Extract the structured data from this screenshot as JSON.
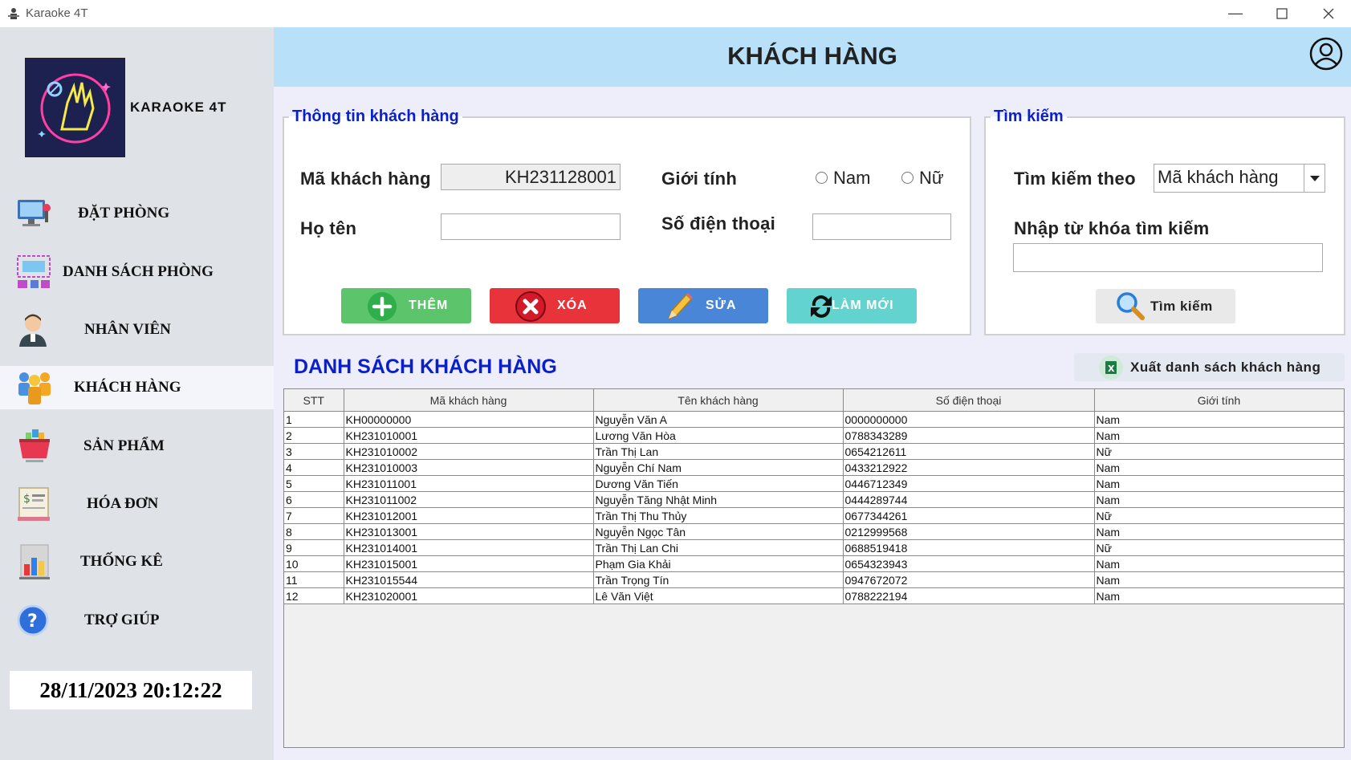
{
  "window": {
    "title": "Karaoke 4T"
  },
  "brand": {
    "name": "KARAOKE 4T"
  },
  "sidebar": {
    "items": [
      {
        "label": "ĐẶT PHÒNG",
        "icon": "booking-icon"
      },
      {
        "label": "DANH SÁCH PHÒNG",
        "icon": "room-list-icon"
      },
      {
        "label": "NHÂN VIÊN",
        "icon": "employee-icon"
      },
      {
        "label": "KHÁCH HÀNG",
        "icon": "customers-icon",
        "active": true
      },
      {
        "label": "SẢN PHẨM",
        "icon": "product-basket-icon"
      },
      {
        "label": "HÓA ĐƠN",
        "icon": "invoice-icon"
      },
      {
        "label": "THỐNG KÊ",
        "icon": "stats-chart-icon"
      },
      {
        "label": "TRỢ GIÚP",
        "icon": "help-icon"
      }
    ],
    "clock": "28/11/2023 20:12:22"
  },
  "header": {
    "title": "KHÁCH HÀNG"
  },
  "info_panel": {
    "legend": "Thông tin khách hàng",
    "code_label": "Mã khách hàng",
    "code_value": "KH231128001",
    "name_label": "Họ tên",
    "name_value": "",
    "gender_label": "Giới tính",
    "gender_male": "Nam",
    "gender_female": "Nữ",
    "phone_label": "Số điện thoại",
    "phone_value": "",
    "buttons": {
      "add": "THÊM",
      "delete": "XÓA",
      "edit": "SỬA",
      "refresh": "LÀM MỚI"
    }
  },
  "search_panel": {
    "legend": "Tìm kiếm",
    "by_label": "Tìm kiếm theo",
    "by_value": "Mã khách hàng",
    "keyword_label": "Nhập từ khóa tìm kiếm",
    "keyword_value": "",
    "search_button": "Tìm kiếm"
  },
  "list": {
    "title": "DANH SÁCH KHÁCH HÀNG",
    "export_button": "Xuất danh sách khách hàng",
    "columns": [
      "STT",
      "Mã khách hàng",
      "Tên khách hàng",
      "Số điện thoại",
      "Giới tính"
    ],
    "rows": [
      [
        "1",
        "KH00000000",
        "Nguyễn Văn A",
        "0000000000",
        "Nam"
      ],
      [
        "2",
        "KH231010001",
        "Lương Văn Hòa",
        "0788343289",
        "Nam"
      ],
      [
        "3",
        "KH231010002",
        "Trần Thị Lan",
        "0654212611",
        "Nữ"
      ],
      [
        "4",
        "KH231010003",
        "Nguyễn Chí Nam",
        "0433212922",
        "Nam"
      ],
      [
        "5",
        "KH231011001",
        "Dương Văn Tiến",
        "0446712349",
        "Nam"
      ],
      [
        "6",
        "KH231011002",
        "Nguyễn Tăng Nhật Minh",
        "0444289744",
        "Nam"
      ],
      [
        "7",
        "KH231012001",
        "Trần Thị Thu Thủy",
        "0677344261",
        "Nữ"
      ],
      [
        "8",
        "KH231013001",
        "Nguyễn Ngọc Tân",
        "0212999568",
        "Nam"
      ],
      [
        "9",
        "KH231014001",
        "Trần Thị Lan Chi",
        "0688519418",
        "Nữ"
      ],
      [
        "10",
        "KH231015001",
        "Phạm Gia Khải",
        "0654323943",
        "Nam"
      ],
      [
        "11",
        "KH231015544",
        "Trần Trọng Tín",
        "0947672072",
        "Nam"
      ],
      [
        "12",
        "KH231020001",
        "Lê Văn Việt",
        "0788222194",
        "Nam"
      ]
    ]
  },
  "colors": {
    "header_bg": "#b8e1f9",
    "sidebar_bg": "#dfe3e8",
    "add_button": "#5cc46b",
    "delete_button": "#e8333a",
    "edit_button": "#4a86d8",
    "refresh_button": "#63d3d0",
    "legend_text": "#0a1fc8"
  }
}
